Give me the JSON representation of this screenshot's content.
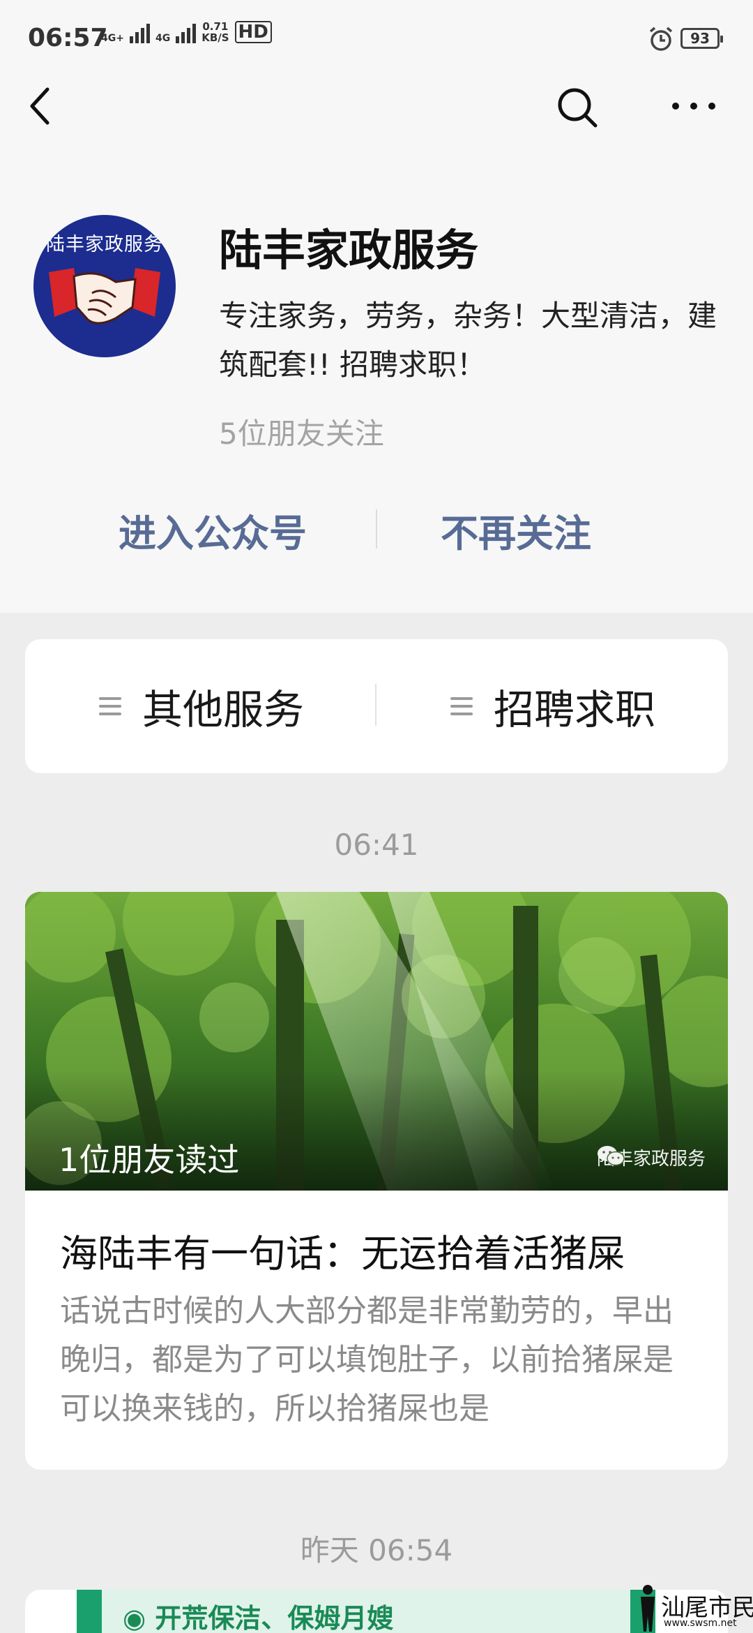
{
  "status_bar": {
    "time": "06:57",
    "network_1": "4G+",
    "network_2": "4G",
    "speed_value": "0.71",
    "speed_unit": "KB/S",
    "hd": "HD",
    "battery": "93"
  },
  "profile": {
    "avatar_text": "陆丰家政服务",
    "name": "陆丰家政服务",
    "intro": "专注家务，劳务，杂务！大型清洁，建筑配套!!  招聘求职！",
    "followers": "5位朋友关注"
  },
  "actions": {
    "enter": "进入公众号",
    "unfollow": "不再关注"
  },
  "menu": {
    "items": [
      {
        "label": "其他服务"
      },
      {
        "label": "招聘求职"
      }
    ]
  },
  "feed": [
    {
      "time": "06:41",
      "read_badge": "1位朋友读过",
      "source": "陆丰家政服务",
      "title": "海陆丰有一句话：无运拾着活猪屎",
      "summary": "话说古时候的人大部分都是非常勤劳的，早出晚归，都是为了可以填饱肚子，以前拾猪屎是可以换来钱的，所以拾猪屎也是"
    },
    {
      "time": "昨天 06:54",
      "banner": "◉ 开荒保洁、保姆月嫂"
    }
  ],
  "watermark": {
    "text": "汕尾市民网",
    "url": "www.swsm.net"
  },
  "colors": {
    "link": "#576b95",
    "background": "#ededed",
    "header_bg": "#f7f7f7",
    "card_bg": "#ffffff",
    "accent_green": "#1aa06d"
  },
  "icons": [
    "back-icon",
    "search-icon",
    "more-icon",
    "menu-icon",
    "wechat-icon",
    "alarm-icon",
    "handshake-icon"
  ]
}
